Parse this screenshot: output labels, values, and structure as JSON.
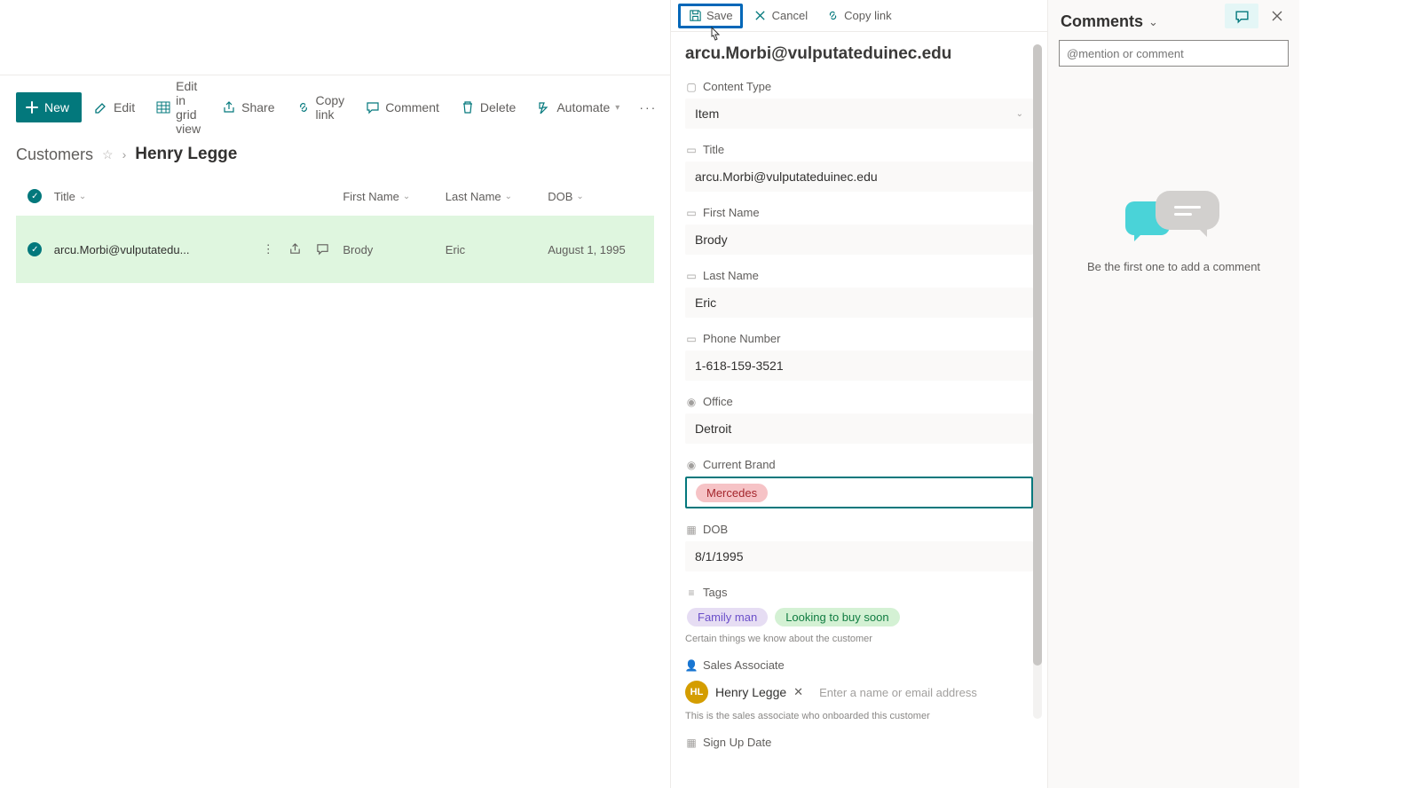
{
  "cmdbar": {
    "new": "New",
    "edit": "Edit",
    "gridview": "Edit in grid view",
    "share": "Share",
    "copylink": "Copy link",
    "comment": "Comment",
    "delete": "Delete",
    "automate": "Automate"
  },
  "breadcrumb": {
    "list": "Customers",
    "current": "Henry Legge"
  },
  "columns": {
    "title": "Title",
    "firstname": "First Name",
    "lastname": "Last Name",
    "dob": "DOB"
  },
  "row": {
    "title": "arcu.Morbi@vulputatedu...",
    "firstname": "Brody",
    "lastname": "Eric",
    "dob": "August 1, 1995"
  },
  "panelcmd": {
    "save": "Save",
    "cancel": "Cancel",
    "copylink": "Copy link"
  },
  "item": {
    "header": "arcu.Morbi@vulputateduinec.edu",
    "labels": {
      "contenttype": "Content Type",
      "title": "Title",
      "firstname": "First Name",
      "lastname": "Last Name",
      "phone": "Phone Number",
      "office": "Office",
      "brand": "Current Brand",
      "dob": "DOB",
      "tags": "Tags",
      "sales": "Sales Associate",
      "signup": "Sign Up Date"
    },
    "values": {
      "contenttype": "Item",
      "title": "arcu.Morbi@vulputateduinec.edu",
      "firstname": "Brody",
      "lastname": "Eric",
      "phone": "1-618-159-3521",
      "office": "Detroit",
      "brand": "Mercedes",
      "dob": "8/1/1995"
    },
    "tags": [
      "Family man",
      "Looking to buy soon"
    ],
    "tags_help": "Certain things we know about the customer",
    "sales_person": "Henry Legge",
    "sales_initials": "HL",
    "sales_placeholder": "Enter a name or email address",
    "sales_help": "This is the sales associate who onboarded this customer"
  },
  "comments": {
    "title": "Comments",
    "placeholder": "@mention or comment",
    "empty": "Be the first one to add a comment"
  }
}
